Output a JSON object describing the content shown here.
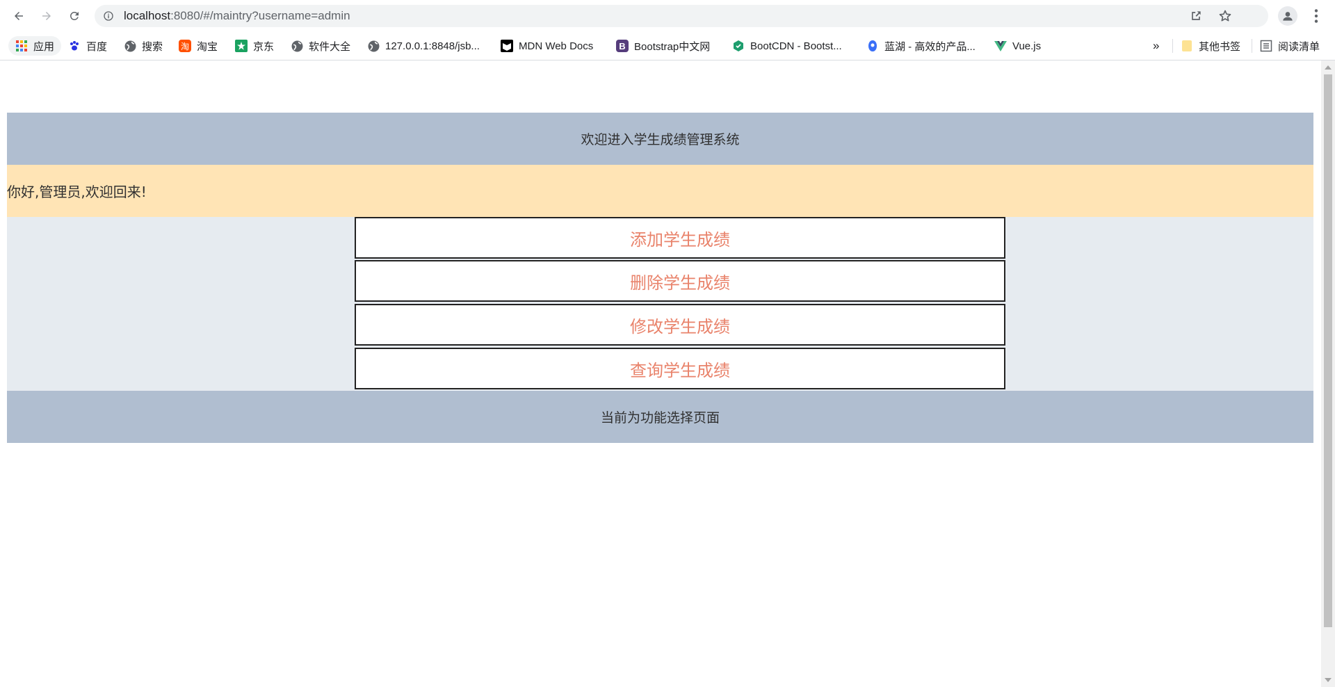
{
  "browser": {
    "url_host": "localhost",
    "url_rest": ":8080/#/maintry?username=admin",
    "bookmarks": [
      {
        "label": "应用",
        "icon": "apps-grid-icon"
      },
      {
        "label": "百度",
        "icon": "baidu-paw-icon"
      },
      {
        "label": "搜索",
        "icon": "globe-icon"
      },
      {
        "label": "淘宝",
        "icon": "taobao-icon"
      },
      {
        "label": "京东",
        "icon": "jd-icon"
      },
      {
        "label": "软件大全",
        "icon": "globe-icon"
      },
      {
        "label": "127.0.0.1:8848/jsb...",
        "icon": "globe-icon"
      },
      {
        "label": "MDN Web Docs",
        "icon": "mdn-icon"
      },
      {
        "label": "Bootstrap中文网",
        "icon": "bootstrap-icon"
      },
      {
        "label": "BootCDN - Bootst...",
        "icon": "bootcdn-icon"
      },
      {
        "label": "蓝湖 - 高效的产品...",
        "icon": "lanhu-icon"
      },
      {
        "label": "Vue.js",
        "icon": "vue-icon"
      }
    ],
    "overflow_label": "»",
    "other_bookmarks": "其他书签",
    "reading_list": "阅读清单"
  },
  "page": {
    "header_title": "欢迎进入学生成绩管理系统",
    "welcome_text": "你好,管理员,欢迎回来!",
    "menu": [
      {
        "label": "添加学生成绩"
      },
      {
        "label": "删除学生成绩"
      },
      {
        "label": "修改学生成绩"
      },
      {
        "label": "查询学生成绩"
      }
    ],
    "footer_text": "当前为功能选择页面"
  },
  "colors": {
    "header_bg": "#b0bed0",
    "welcome_bg": "#ffe4b5",
    "menu_area_bg": "#e6ebf0",
    "menu_text": "#e9836b"
  }
}
